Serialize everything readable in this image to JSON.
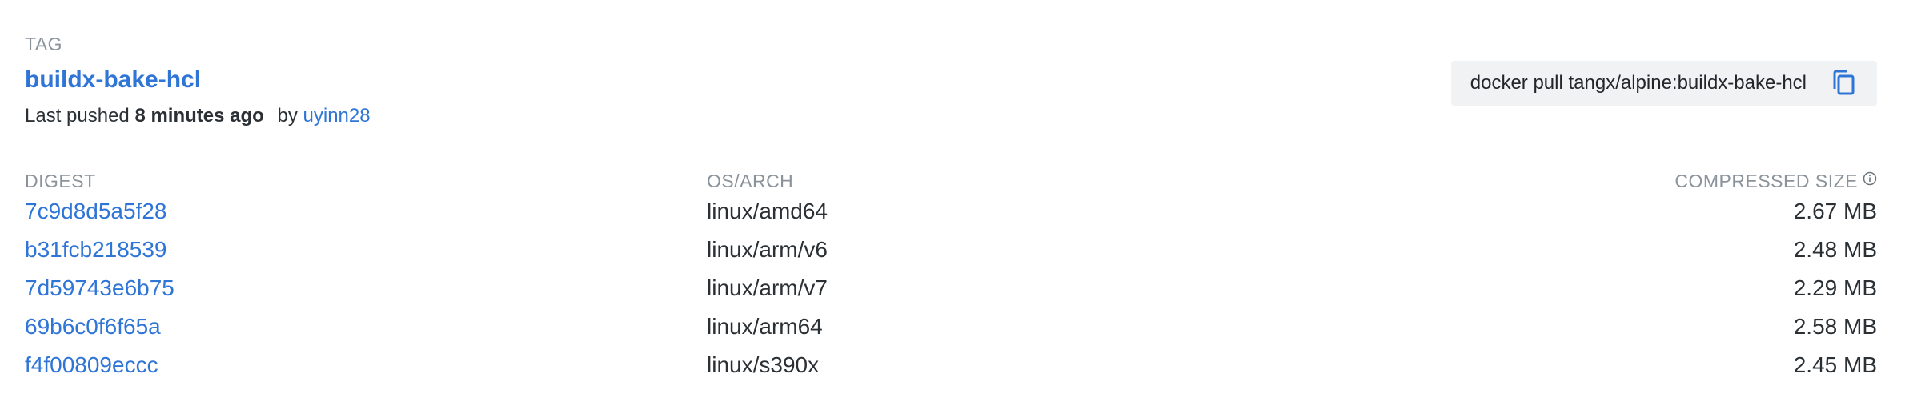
{
  "tag": {
    "caption": "TAG",
    "name": "buildx-bake-hcl",
    "pushed_prefix": "Last pushed",
    "pushed_time": "8 minutes ago",
    "by_label": "by",
    "user": "uyinn28"
  },
  "pull": {
    "command": "docker pull tangx/alpine:buildx-bake-hcl",
    "copy_icon": "copy-icon"
  },
  "table": {
    "headers": {
      "digest": "DIGEST",
      "os_arch": "OS/ARCH",
      "size": "COMPRESSED SIZE",
      "size_info_icon": "info-icon"
    },
    "rows": [
      {
        "digest": "7c9d8d5a5f28",
        "os_arch": "linux/amd64",
        "size": "2.67 MB"
      },
      {
        "digest": "b31fcb218539",
        "os_arch": "linux/arm/v6",
        "size": "2.48 MB"
      },
      {
        "digest": "7d59743e6b75",
        "os_arch": "linux/arm/v7",
        "size": "2.29 MB"
      },
      {
        "digest": "69b6c0f6f65a",
        "os_arch": "linux/arm64",
        "size": "2.58 MB"
      },
      {
        "digest": "f4f00809eccc",
        "os_arch": "linux/s390x",
        "size": "2.45 MB"
      }
    ]
  },
  "colors": {
    "link": "#2f75d6",
    "muted": "#8a939b",
    "text": "#2b3035",
    "pull_bg": "#f1f2f3"
  }
}
